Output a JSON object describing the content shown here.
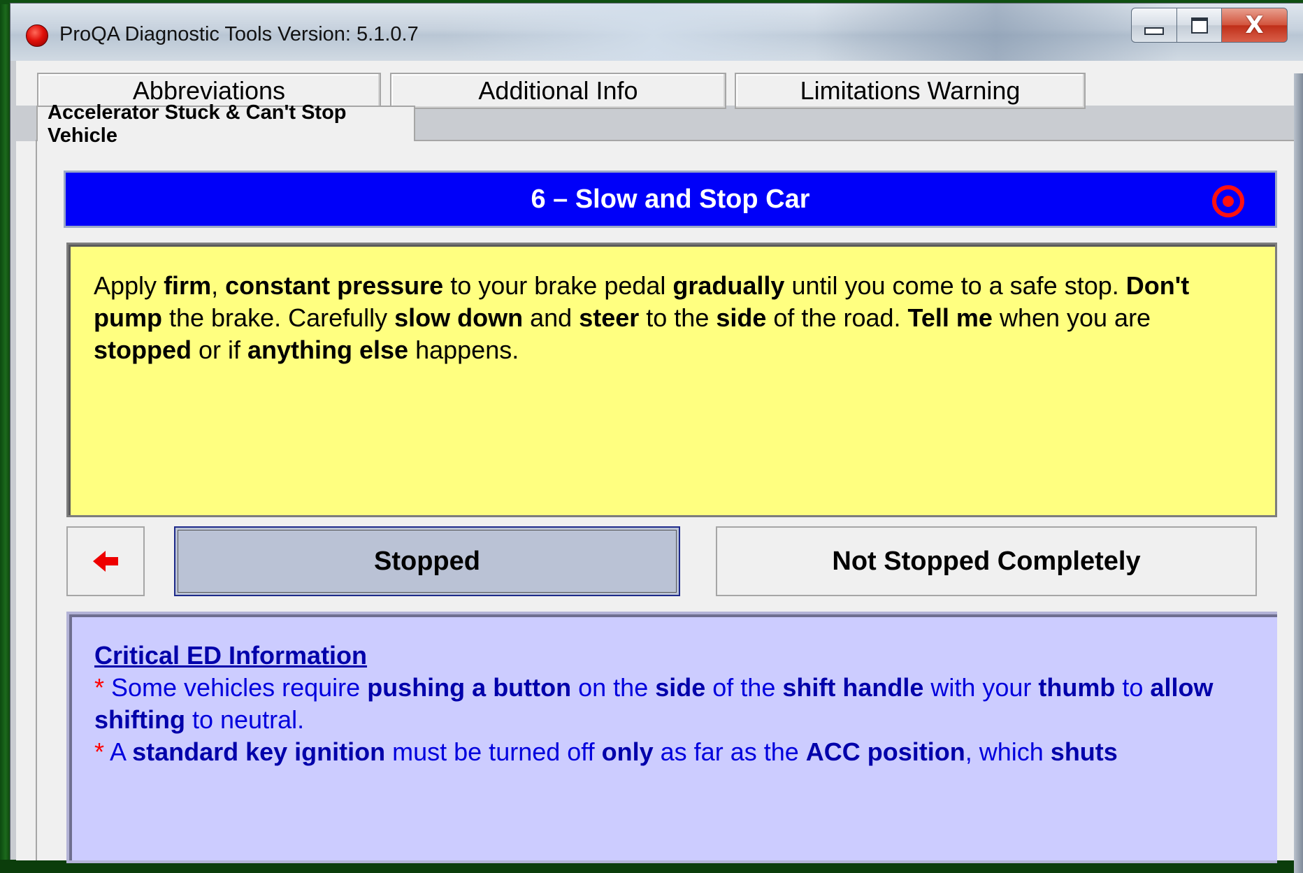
{
  "window": {
    "title": "ProQA Diagnostic Tools Version: 5.1.0.7",
    "controls": {
      "minimize": "minimize",
      "maximize": "maximize",
      "close": "X"
    }
  },
  "toolbar": {
    "buttons": [
      "Abbreviations",
      "Additional Info",
      "Limitations Warning"
    ]
  },
  "tab": {
    "label": "Accelerator Stuck & Can't Stop Vehicle"
  },
  "step": {
    "title": "6 – Slow and Stop Car"
  },
  "instruction": {
    "segments": [
      {
        "t": "Apply "
      },
      {
        "t": "firm",
        "b": true
      },
      {
        "t": ", "
      },
      {
        "t": "constant pressure",
        "b": true
      },
      {
        "t": " to your brake pedal "
      },
      {
        "t": "gradually",
        "b": true
      },
      {
        "t": " until you come to a safe stop. "
      },
      {
        "t": "Don't pump",
        "b": true
      },
      {
        "t": " the brake. Carefully "
      },
      {
        "t": "slow down",
        "b": true
      },
      {
        "t": " and "
      },
      {
        "t": "steer",
        "b": true
      },
      {
        "t": " to the "
      },
      {
        "t": "side",
        "b": true
      },
      {
        "t": " of the road. "
      },
      {
        "t": "Tell me",
        "b": true
      },
      {
        "t": " when you are "
      },
      {
        "t": "stopped",
        "b": true
      },
      {
        "t": " or if "
      },
      {
        "t": "anything else",
        "b": true
      },
      {
        "t": " happens."
      }
    ]
  },
  "answers": {
    "back_icon": "arrow-left-icon",
    "stopped": "Stopped",
    "not_stopped": "Not Stopped Completely"
  },
  "critical_info": {
    "title": "Critical ED Information",
    "lines": [
      [
        {
          "t": "* ",
          "star": true
        },
        {
          "t": "Some vehicles require "
        },
        {
          "t": "pushing a button",
          "b": true
        },
        {
          "t": " on the "
        },
        {
          "t": "side",
          "b": true
        },
        {
          "t": " of the "
        },
        {
          "t": "shift handle",
          "b": true
        },
        {
          "t": " with your "
        },
        {
          "t": "thumb",
          "b": true
        },
        {
          "t": " to "
        },
        {
          "t": "allow shifting",
          "b": true
        },
        {
          "t": " to neutral."
        }
      ],
      [
        {
          "t": "* ",
          "star": true
        },
        {
          "t": "A "
        },
        {
          "t": "standard key ignition",
          "b": true
        },
        {
          "t": " must be turned off "
        },
        {
          "t": "only",
          "b": true
        },
        {
          "t": " as far as the "
        },
        {
          "t": "ACC position",
          "b": true
        },
        {
          "t": ", which "
        },
        {
          "t": "shuts",
          "b": true
        }
      ]
    ]
  },
  "colors": {
    "header_blue": "#0000f9",
    "instruction_yellow": "#ffff80",
    "ed_lavender": "#ccccff",
    "selected_answer": "#bac2d5"
  }
}
